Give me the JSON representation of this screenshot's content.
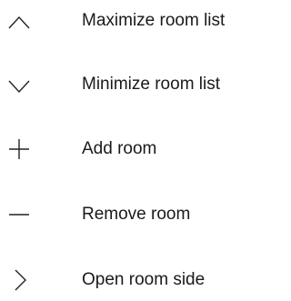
{
  "menu": {
    "items": [
      {
        "icon": "chevron-up-icon",
        "label": "Maximize room list"
      },
      {
        "icon": "chevron-down-icon",
        "label": "Minimize room list"
      },
      {
        "icon": "plus-icon",
        "label": "Add room"
      },
      {
        "icon": "minus-icon",
        "label": "Remove room"
      },
      {
        "icon": "chevron-right-icon",
        "label": "Open room side"
      }
    ]
  },
  "colors": {
    "icon": "#222222",
    "text": "#1a1a1a",
    "background": "#ffffff"
  }
}
